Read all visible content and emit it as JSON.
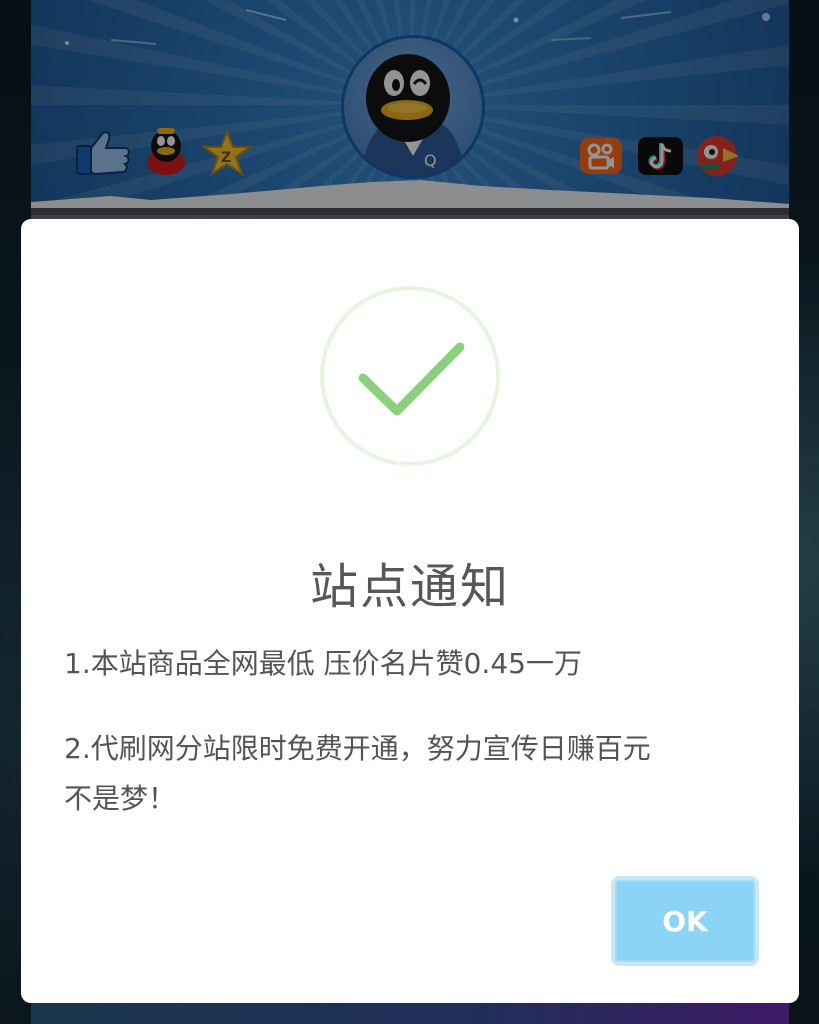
{
  "banner": {
    "avatar_name": "qq-penguin-avatar",
    "left_icons": [
      "thumbs-up-icon",
      "qq-mascot-icon",
      "qzone-star-icon"
    ],
    "right_icons": [
      "kuaishou-icon",
      "douyin-icon",
      "parrot-icon"
    ],
    "colors": {
      "sky": "#2b6fb3",
      "avatar_border": "#1d5fa8"
    }
  },
  "dialog": {
    "icon": "success-check-icon",
    "title": "站点通知",
    "line1": "1.本站商品全网最低 压价名片赞0.45一万",
    "line2a": "2.代刷网分站限时免费开通，努力宣传日赚百元",
    "line2b": "不是梦！",
    "ok_label": "OK",
    "colors": {
      "check": "#8bd17c",
      "ring": "#e6f5e1",
      "ok_button": "#8cd4f5"
    }
  }
}
